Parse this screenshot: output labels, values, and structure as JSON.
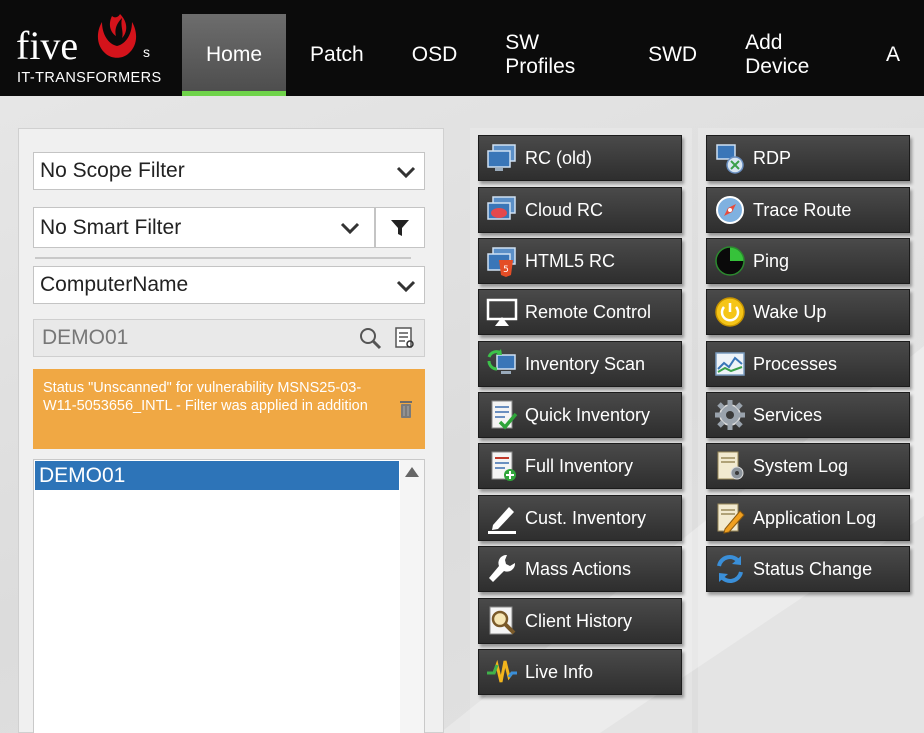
{
  "brand": {
    "name": "five",
    "suffix": "s",
    "tagline": "IT-TRANSFORMERS"
  },
  "nav": {
    "items": [
      {
        "label": "Home",
        "active": true
      },
      {
        "label": "Patch"
      },
      {
        "label": "OSD"
      },
      {
        "label": "SW Profiles"
      },
      {
        "label": "SWD"
      },
      {
        "label": "Add Device"
      },
      {
        "label": "A"
      }
    ]
  },
  "filters": {
    "scope": "No Scope Filter",
    "smart": "No Smart Filter",
    "field": "ComputerName",
    "search_value": "DEMO01"
  },
  "alert": {
    "text": "Status \"Unscanned\" for vulnerability MSNS25-03-W11-5053656_INTL - Filter was applied in addition",
    "color": "#f0a844"
  },
  "results": {
    "items": [
      "DEMO01"
    ],
    "selected": "DEMO01"
  },
  "actions_left": [
    {
      "label": "RC (old)",
      "icon": "rc-monitor-icon"
    },
    {
      "label": "Cloud RC",
      "icon": "cloud-rc-icon"
    },
    {
      "label": "HTML5 RC",
      "icon": "html5-rc-icon"
    },
    {
      "label": "Remote Control",
      "icon": "remote-control-icon"
    },
    {
      "label": "Inventory Scan",
      "icon": "inventory-scan-icon"
    },
    {
      "label": "Quick Inventory",
      "icon": "quick-inventory-icon"
    },
    {
      "label": "Full Inventory",
      "icon": "full-inventory-icon"
    },
    {
      "label": "Cust. Inventory",
      "icon": "pencil-icon"
    },
    {
      "label": "Mass Actions",
      "icon": "wrench-icon"
    },
    {
      "label": "Client History",
      "icon": "history-magnifier-icon"
    },
    {
      "label": "Live Info",
      "icon": "pulse-icon"
    }
  ],
  "actions_right": [
    {
      "label": "RDP",
      "icon": "rdp-icon"
    },
    {
      "label": "Trace Route",
      "icon": "compass-icon"
    },
    {
      "label": "Ping",
      "icon": "radar-icon"
    },
    {
      "label": "Wake Up",
      "icon": "power-icon"
    },
    {
      "label": "Processes",
      "icon": "processes-icon"
    },
    {
      "label": "Services",
      "icon": "gear-icon"
    },
    {
      "label": "System Log",
      "icon": "system-log-icon"
    },
    {
      "label": "Application Log",
      "icon": "application-log-icon"
    },
    {
      "label": "Status Change",
      "icon": "refresh-icon"
    }
  ],
  "colors": {
    "accent": "#6fd34a",
    "brand_red": "#d4131b",
    "selection": "#2d74b8"
  }
}
